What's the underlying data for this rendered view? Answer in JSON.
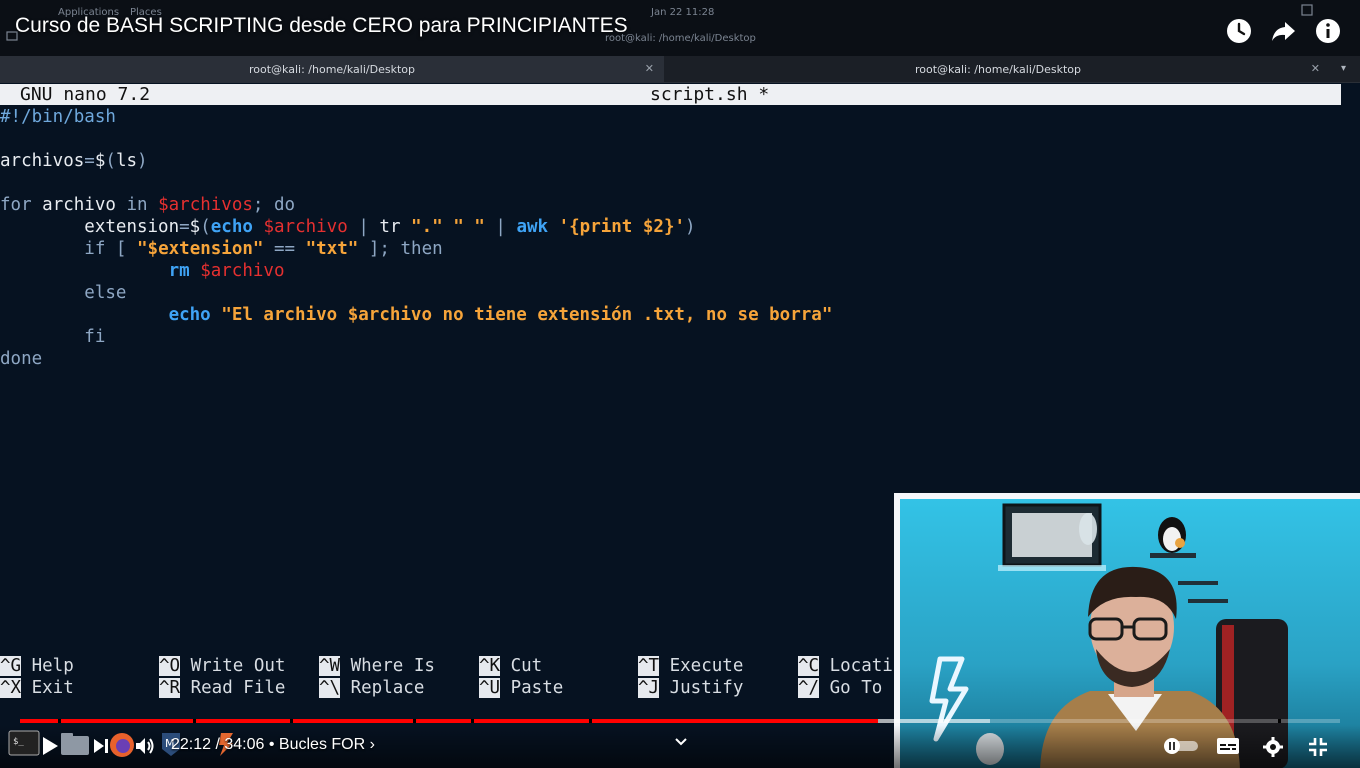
{
  "youtube": {
    "title": "Curso de BASH SCRIPTING desde CERO para PRINCIPIANTES",
    "time": "22:12 / 34:06",
    "chapter": "Bucles FOR",
    "played_fraction": 0.65,
    "buffered_fraction": 0.735,
    "icons": [
      "watch-later-icon",
      "share-icon",
      "info-icon",
      "play-icon",
      "next-icon",
      "volume-icon",
      "chevron-down-icon",
      "autoplay-toggle-icon",
      "subtitles-icon",
      "settings-icon",
      "fullscreen-icon"
    ]
  },
  "desktop": {
    "menu_applications": "Applications",
    "menu_places": "Places",
    "clock": "Jan 22  11:28",
    "window_title": "root@kali: /home/kali/Desktop"
  },
  "terminal": {
    "tabs": [
      {
        "label": "root@kali: /home/kali/Desktop"
      },
      {
        "label": "root@kali: /home/kali/Desktop"
      }
    ]
  },
  "nano": {
    "version": "GNU nano 7.2",
    "filename": "script.sh *",
    "lines": [
      "#!/bin/bash",
      "",
      "archivos=$(ls)",
      "",
      "for archivo in $archivos; do",
      "        extension=$(echo $archivo | tr \".\" \" \" | awk '{print $2}')",
      "        if [ \"$extension\" == \"txt\" ]; then",
      "                rm $archivo",
      "        else",
      "                echo \"El archivo $archivo no tiene extensión .txt, no se borra\"",
      "        fi",
      "done"
    ],
    "shortcuts": [
      {
        "key": "^G",
        "label": "Help"
      },
      {
        "key": "^X",
        "label": "Exit"
      },
      {
        "key": "^O",
        "label": "Write Out"
      },
      {
        "key": "^R",
        "label": "Read File"
      },
      {
        "key": "^W",
        "label": "Where Is"
      },
      {
        "key": "^\\",
        "label": "Replace"
      },
      {
        "key": "^K",
        "label": "Cut"
      },
      {
        "key": "^U",
        "label": "Paste"
      },
      {
        "key": "^T",
        "label": "Execute"
      },
      {
        "key": "^J",
        "label": "Justify"
      },
      {
        "key": "^C",
        "label": "Locati"
      },
      {
        "key": "^/",
        "label": "Go To"
      }
    ]
  },
  "colors": {
    "progress_played": "#ff0000",
    "nano_background": "#061221",
    "string": "#f6a43a",
    "variable": "#e53030",
    "command": "#3fa3f5"
  }
}
